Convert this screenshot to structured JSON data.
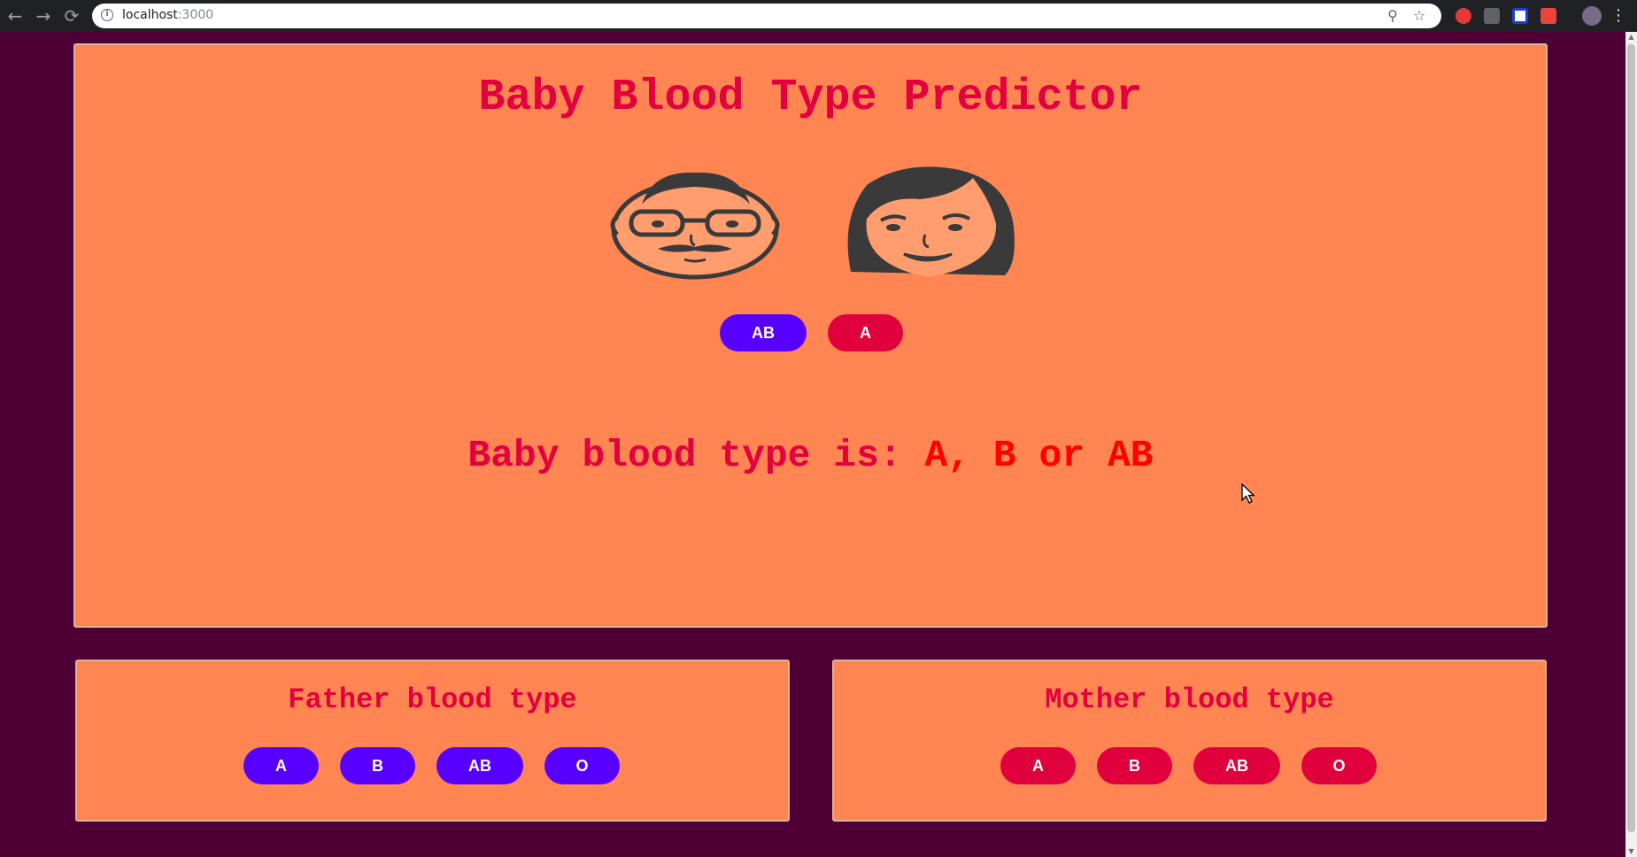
{
  "browser": {
    "url_host": "localhost",
    "url_port": ":3000",
    "nav": {
      "back_icon": "←",
      "forward_icon": "→",
      "reload_icon": "⟳"
    },
    "menu_icon": "⋮",
    "zoom_icon": "⚲",
    "bookmark_icon": "☆",
    "info_icon": "i"
  },
  "app": {
    "title": "Baby Blood Type Predictor",
    "selected_father": "AB",
    "selected_mother": "A",
    "result_label": "Baby blood type is:",
    "result_value": "A, B or AB"
  },
  "father_panel": {
    "title": "Father blood type",
    "options": [
      "A",
      "B",
      "AB",
      "O"
    ]
  },
  "mother_panel": {
    "title": "Mother blood type",
    "options": [
      "A",
      "B",
      "AB",
      "O"
    ]
  },
  "colors": {
    "page_background": "#4e0035",
    "card": "#ff8552",
    "title_text": "#e3003e",
    "result_value": "#ff0000",
    "father_button": "#5800ff",
    "mother_button": "#e0003c"
  }
}
